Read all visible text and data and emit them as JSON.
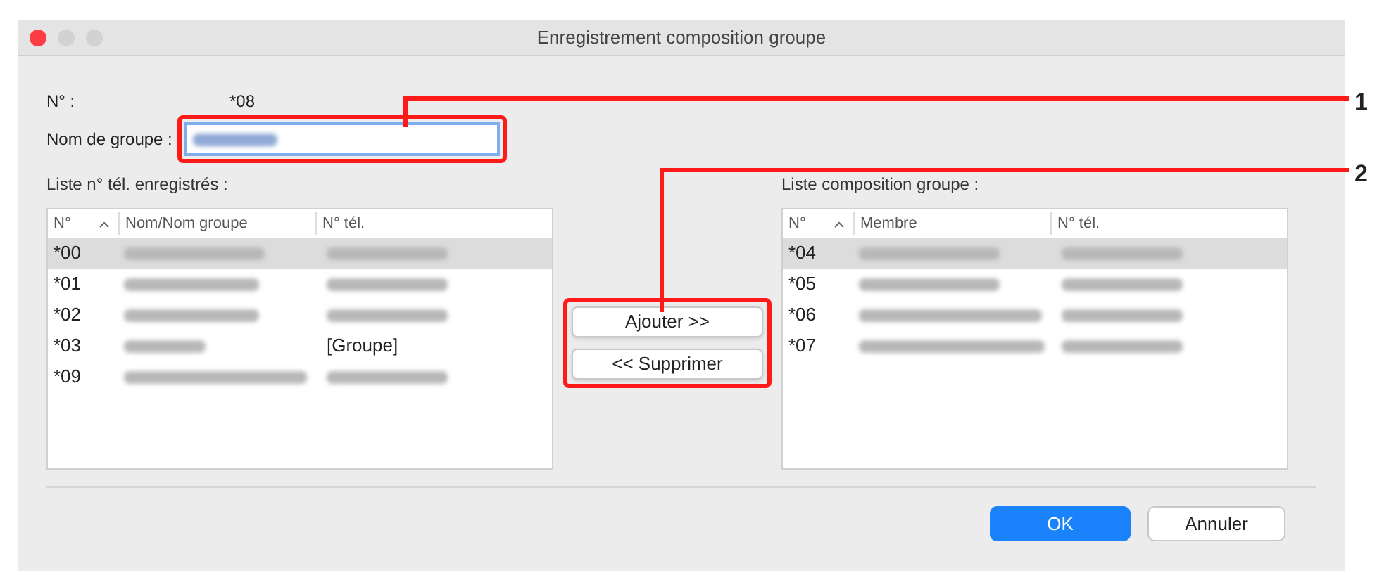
{
  "window": {
    "title": "Enregistrement composition groupe"
  },
  "number": {
    "label": "N° :",
    "value": "*08"
  },
  "group_name": {
    "label": "Nom de groupe :"
  },
  "left_list": {
    "title": "Liste n° tél. enregistrés :",
    "columns": [
      "N°",
      "Nom/Nom groupe",
      "N° tél."
    ],
    "rows": [
      {
        "no": "*00",
        "selected": true
      },
      {
        "no": "*01",
        "selected": false
      },
      {
        "no": "*02",
        "selected": false
      },
      {
        "no": "*03",
        "tel": "[Groupe]",
        "selected": false
      },
      {
        "no": "*09",
        "selected": false
      }
    ]
  },
  "buttons_middle": [
    "Ajouter >>",
    "<< Supprimer"
  ],
  "right_list": {
    "title": "Liste composition groupe :",
    "columns": [
      "N°",
      "Membre",
      "N° tél."
    ],
    "rows": [
      {
        "no": "*04",
        "selected": true
      },
      {
        "no": "*05",
        "selected": false
      },
      {
        "no": "*06",
        "selected": false
      },
      {
        "no": "*07",
        "selected": false
      }
    ]
  },
  "footer": {
    "ok": "OK",
    "cancel": "Annuler"
  },
  "callouts": [
    "1",
    "2"
  ]
}
